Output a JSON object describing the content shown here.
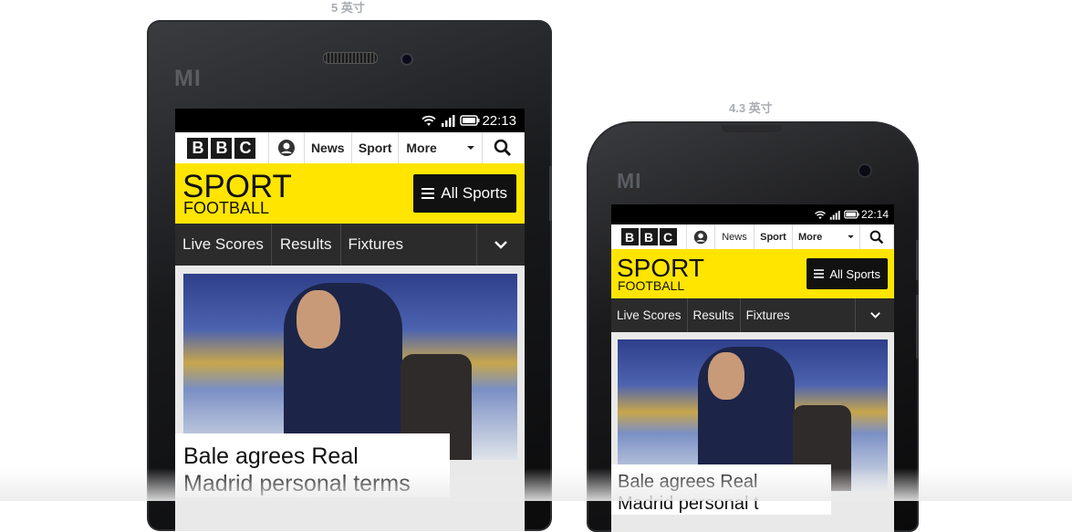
{
  "labels": {
    "large": "5 英寸",
    "small": "4.3 英寸"
  },
  "brand_mark": "MI",
  "colors": {
    "bbc_yellow": "#ffe500",
    "dark": "#111111",
    "subnav_bg": "#2b2b2b"
  },
  "phones": {
    "large": {
      "time": "22:13",
      "bbc": [
        "B",
        "B",
        "C"
      ],
      "nav": {
        "news": "News",
        "sport": "Sport",
        "more": "More"
      },
      "sport": {
        "title": "SPORT",
        "section": "FOOTBALL",
        "all_sports": "All Sports"
      },
      "subnav": {
        "live": "Live Scores",
        "results": "Results",
        "fixtures": "Fixtures"
      },
      "headline": [
        "Bale agrees Real",
        "Madrid personal terms"
      ]
    },
    "small": {
      "time": "22:14",
      "bbc": [
        "B",
        "B",
        "C"
      ],
      "nav": {
        "news": "News",
        "sport": "Sport",
        "more": "More"
      },
      "sport": {
        "title": "SPORT",
        "section": "FOOTBALL",
        "all_sports": "All Sports"
      },
      "subnav": {
        "live": "Live Scores",
        "results": "Results",
        "fixtures": "Fixtures"
      },
      "headline": [
        "Bale agrees Real",
        "Madrid personal t"
      ]
    }
  },
  "icons": [
    "wifi-icon",
    "signal-icon",
    "battery-icon",
    "avatar-icon",
    "chevron-down-icon",
    "search-icon",
    "menu-icon",
    "chevron-down-icon"
  ]
}
